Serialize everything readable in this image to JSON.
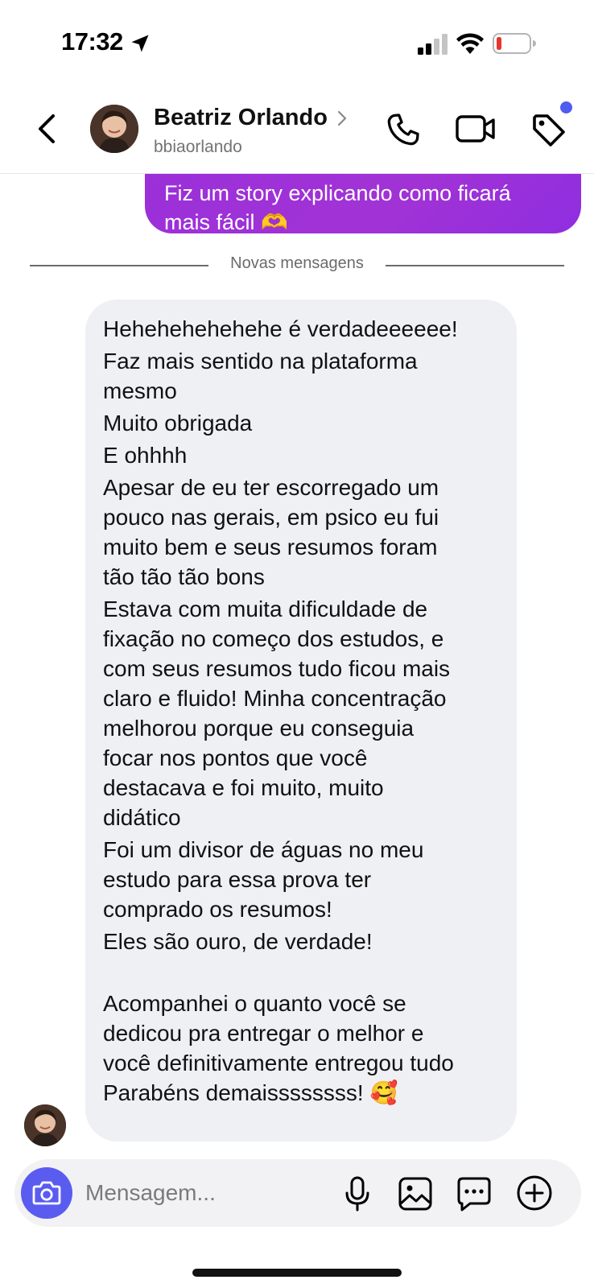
{
  "status_bar": {
    "time": "17:32",
    "icons": [
      "location-arrow-icon",
      "cellular-signal-icon",
      "wifi-icon",
      "battery-low-icon"
    ],
    "battery_color": "#e5362f"
  },
  "header": {
    "contact_name": "Beatriz Orlando",
    "username": "bbiaorlando",
    "icons": [
      "back-arrow-icon",
      "chevron-right-icon",
      "phone-icon",
      "video-camera-icon",
      "tag-icon"
    ],
    "notification_dot_color": "#4f5cf0"
  },
  "chat": {
    "sent_message": {
      "lines": [
        "Fiz um story explicando como ficará",
        "mais fácil 🫶"
      ],
      "color": "#9b30d9"
    },
    "divider_label": "Novas mensagens",
    "received_message": {
      "lines": [
        "Hehehehehehehe é verdadeeeeee!",
        "Faz mais sentido na plataforma",
        "mesmo",
        "Muito obrigada",
        "E ohhhh",
        "Apesar de eu ter escorregado um",
        "pouco nas gerais, em psico eu fui",
        "muito bem e seus resumos foram",
        "tão tão tão bons",
        "Estava com muita dificuldade de",
        "fixação no começo dos estudos, e",
        "com seus resumos tudo ficou mais",
        "claro e fluido! Minha concentração",
        "melhorou porque eu conseguia",
        "focar nos pontos que você",
        "destacava e foi muito, muito",
        "didático",
        "Foi um divisor de águas no meu",
        "estudo para essa prova ter",
        "comprado os resumos!",
        "Eles são ouro, de verdade!",
        "",
        "Acompanhei o quanto você se",
        "dedicou pra entregar o melhor e",
        "você definitivamente entregou tudo",
        "Parabéns demaissssssss! 🥰"
      ]
    }
  },
  "composer": {
    "placeholder": "Mensagem...",
    "icons": [
      "camera-icon",
      "microphone-icon",
      "image-icon",
      "sticker-chat-icon",
      "plus-circle-icon"
    ],
    "camera_button_color": "#5a5cf0"
  }
}
